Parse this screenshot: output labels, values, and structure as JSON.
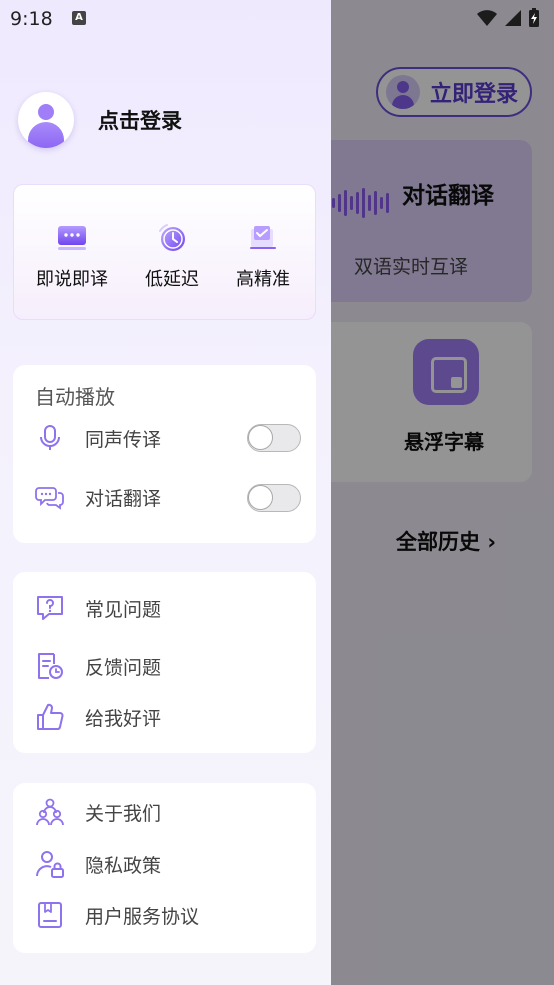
{
  "status_bar": {
    "time": "9:18",
    "a_badge": "A"
  },
  "background": {
    "login_button": "立即登录",
    "dialog_card": {
      "title": "对话翻译",
      "subtitle": "双语实时互译"
    },
    "float_card": {
      "label": "悬浮字幕"
    },
    "history": {
      "label": "全部历史",
      "chevron": "›"
    }
  },
  "drawer": {
    "profile": {
      "login_text": "点击登录"
    },
    "features": [
      {
        "label": "即说即译",
        "icon": "chat-box-icon"
      },
      {
        "label": "低延迟",
        "icon": "clock-icon"
      },
      {
        "label": "高精准",
        "icon": "precision-icon"
      }
    ],
    "auto_play": {
      "title": "自动播放",
      "items": [
        {
          "label": "同声传译",
          "icon": "microphone-icon",
          "enabled": false
        },
        {
          "label": "对话翻译",
          "icon": "chat-bubbles-icon",
          "enabled": false
        }
      ]
    },
    "help": {
      "items": [
        {
          "label": "常见问题",
          "icon": "question-icon"
        },
        {
          "label": "反馈问题",
          "icon": "feedback-icon"
        },
        {
          "label": "给我好评",
          "icon": "thumbs-up-icon"
        }
      ]
    },
    "about": {
      "items": [
        {
          "label": "关于我们",
          "icon": "team-icon"
        },
        {
          "label": "隐私政策",
          "icon": "user-lock-icon"
        },
        {
          "label": "用户服务协议",
          "icon": "book-icon"
        }
      ]
    }
  },
  "colors": {
    "accent": "#7b5cf0",
    "drawer_bg": "#efe9fe",
    "toggle_off": "#e9e9ec"
  }
}
